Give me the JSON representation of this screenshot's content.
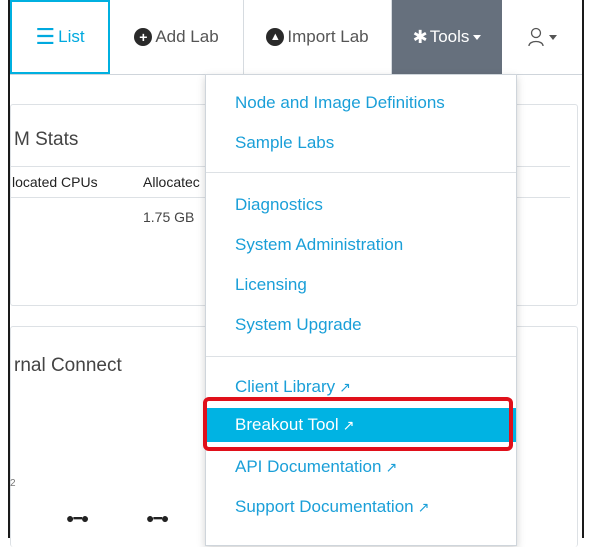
{
  "navbar": {
    "list_label": "List",
    "add_lab_label": "Add Lab",
    "import_lab_label": "Import Lab",
    "tools_label": "Tools"
  },
  "stats_panel": {
    "title": "M Stats",
    "col_allocated_cpus": "located CPUs",
    "col_allocated": "Allocatec",
    "value_memory": "1.75 GB"
  },
  "external_panel": {
    "title": "rnal Connect",
    "tiny_number": "2"
  },
  "tools_menu": {
    "group1": [
      "Node and Image Definitions",
      "Sample Labs"
    ],
    "group2": [
      "Diagnostics",
      "System Administration",
      "Licensing",
      "System Upgrade"
    ],
    "group3": [
      "Client Library",
      "Breakout Tool",
      "API Documentation",
      "Support Documentation"
    ],
    "active_item": "Breakout Tool"
  },
  "colors": {
    "accent": "#00a9df",
    "tools_bg": "#66707d",
    "active_bg": "#00b3e3",
    "highlight_border": "#e0101a"
  },
  "icons": {
    "list": "list-icon",
    "add": "plus-circle-icon",
    "import": "upload-circle-icon",
    "tools": "gear-icon",
    "user": "user-icon",
    "external": "external-link-icon"
  }
}
